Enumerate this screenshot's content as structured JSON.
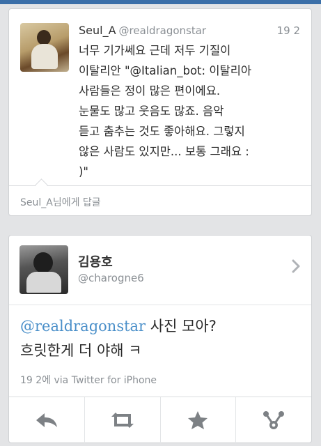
{
  "tweet1": {
    "name": "Seul_A",
    "handle": "@realdragonstar",
    "time": "19 2",
    "text": "너무 기가쎄요 근데 저두 기질이\n이탈리안 \"@Italian_bot: 이탈리아\n사람들은 정이 많은 편이에요.\n눈물도 많고 웃음도 많죠. 음악\n듣고 춤추는 것도 좋아해요. 그렇지\n않은 사람도 있지만... 보통 그래요 :\n)\"",
    "reply_label": "Seul_A님에게 답글"
  },
  "tweet2": {
    "name": "김용호",
    "handle": "@charogne6",
    "mention": "@realdragonstar",
    "text_line1": " 사진 모아?",
    "text_line2": "흐릿한게 더 야해 ㅋ",
    "meta": "19 2에 via Twitter for iPhone"
  },
  "icons": {
    "reply": "reply-icon",
    "retweet": "retweet-icon",
    "favorite": "star-icon",
    "share": "share-icon",
    "chevron": "chevron-right-icon"
  },
  "colors": {
    "accent": "#4a8fc9",
    "topbar": "#3b6fa8",
    "icon": "#7d8185"
  }
}
